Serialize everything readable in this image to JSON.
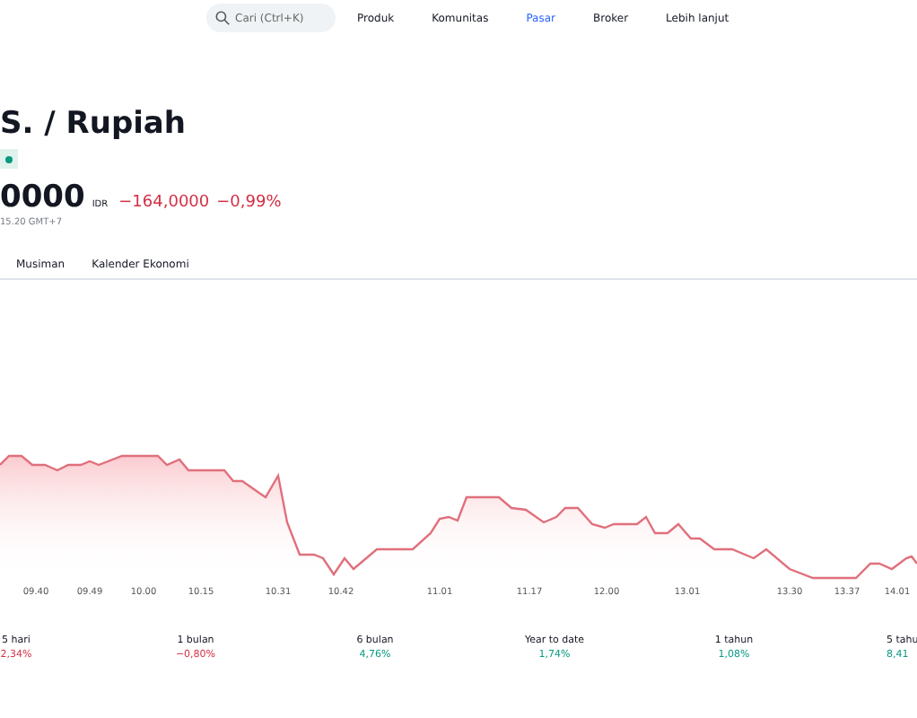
{
  "nav": {
    "search": {
      "placeholder": "Cari (Ctrl+K)"
    },
    "items": [
      {
        "label": "Produk",
        "selected": false
      },
      {
        "label": "Komunitas",
        "selected": false
      },
      {
        "label": "Pasar",
        "selected": true
      },
      {
        "label": "Broker",
        "selected": false
      },
      {
        "label": "Lebih lanjut",
        "selected": false
      }
    ]
  },
  "title": "S. / Rupiah",
  "price": {
    "value": "0000",
    "currency": "IDR",
    "change": "−164,0000",
    "change_percent": "−0,99%",
    "time": "15.20 GMT+7"
  },
  "tabs": [
    {
      "label": "Musiman",
      "selected": false
    },
    {
      "label": "Kalender Ekonomi",
      "selected": false
    }
  ],
  "chart": {
    "kind": "picture",
    "x_labels": [
      "09.40",
      "09.49",
      "10.00",
      "10.15",
      "10.31",
      "10.42",
      "11.01",
      "11.17",
      "12.00",
      "13.01",
      "13.30",
      "13.37",
      "14.01"
    ]
  },
  "periods": [
    {
      "label": "5 hari",
      "value": "2,34%",
      "color": "#d32f45"
    },
    {
      "label": "1 bulan",
      "value": "−0,80%",
      "color": "#d32f45"
    },
    {
      "label": "6 bulan",
      "value": "4,76%",
      "color": "#089981"
    },
    {
      "label": "Year to date",
      "value": "1,74%",
      "color": "#089981"
    },
    {
      "label": "1 tahun",
      "value": "1,08%",
      "color": "#089981"
    },
    {
      "label": "5 tahu",
      "value": "8,41",
      "color": "#089981"
    }
  ]
}
